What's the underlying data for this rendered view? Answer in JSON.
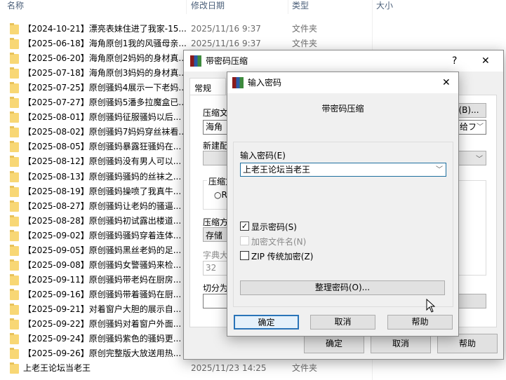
{
  "explorer": {
    "columns": {
      "name": "名称",
      "modified": "修改日期",
      "type": "类型",
      "size": "大小"
    },
    "rows": [
      {
        "name": "【2024-10-21】漂亮表妹住进了我家-15...",
        "date": "2025/11/16 9:37",
        "type": "文件夹"
      },
      {
        "name": "【2025-06-18】海角原创1我的风骚母亲...",
        "date": "2025/11/16 9:37",
        "type": "文件夹"
      },
      {
        "name": "【2025-06-20】海角原创2妈妈的身材真..."
      },
      {
        "name": "【2025-07-18】海角原创3妈妈的身材真..."
      },
      {
        "name": "【2025-07-25】原创骚妈4展示一下老妈..."
      },
      {
        "name": "【2025-07-27】原创骚妈5潘多拉魔盒已..."
      },
      {
        "name": "【2025-08-01】原创骚妈征服骚妈以后..."
      },
      {
        "name": "【2025-08-02】原创骚妈7妈妈穿丝袜看..."
      },
      {
        "name": "【2025-08-05】原创骚妈暴露狂骚妈在..."
      },
      {
        "name": "【2025-08-12】原创骚妈没有男人可以..."
      },
      {
        "name": "【2025-08-13】原创骚妈骚妈的丝袜之..."
      },
      {
        "name": "【2025-08-19】原创骚妈操喷了我真牛..."
      },
      {
        "name": "【2025-08-27】原创骚妈让老妈的骚逼..."
      },
      {
        "name": "【2025-08-28】原创骚妈初试露出楼道..."
      },
      {
        "name": "【2025-09-02】原创骚妈骚妈穿着连体..."
      },
      {
        "name": "【2025-09-05】原创骚妈黑丝老妈的足..."
      },
      {
        "name": "【2025-09-08】原创骚妈女警骚妈来检..."
      },
      {
        "name": "【2025-09-11】原创骚妈带老妈在厨房..."
      },
      {
        "name": "【2025-09-16】原创骚妈带着骚妈在厨..."
      },
      {
        "name": "【2025-09-21】对着窗户大胆的展示自..."
      },
      {
        "name": "【2025-09-22】原创骚妈对着窗户外面..."
      },
      {
        "name": "【2025-09-24】原创骚妈紫色的骚妈更..."
      },
      {
        "name": "【2025-09-26】原创完整版大放送用热..."
      },
      {
        "name": "上老王论坛当老王",
        "date": "2025/11/23 14:25",
        "type": "文件夹"
      }
    ]
  },
  "archive_dialog": {
    "title": "带密码压缩",
    "help": "?",
    "close": "✕",
    "tab": "常规",
    "archive_name_label": "压缩文",
    "archive_name_value": "海角 【",
    "browse": "(B)...",
    "update_value": "给フ",
    "profile_label": "新建配",
    "format_group": "压缩文",
    "radio_label": "R",
    "method_label": "压缩方",
    "method_value": "存储",
    "dict_label": "字典大",
    "dict_value": "32",
    "split_label": "切分为",
    "ok": "确定",
    "cancel": "取消",
    "help_btn": "帮助"
  },
  "password_dialog": {
    "title": "输入密码",
    "close": "✕",
    "heading": "带密码压缩",
    "password_label": "输入密码(E)",
    "password_value": "上老王论坛当老王",
    "show_password": {
      "label": "显示密码(S)",
      "checked": true
    },
    "encrypt_names": {
      "label": "加密文件名(N)",
      "checked": false,
      "disabled": true
    },
    "zip_legacy": {
      "label": "ZIP 传统加密(Z)",
      "checked": false
    },
    "organize": "整理密码(O)...",
    "ok": "确定",
    "cancel": "取消",
    "help": "帮助"
  }
}
